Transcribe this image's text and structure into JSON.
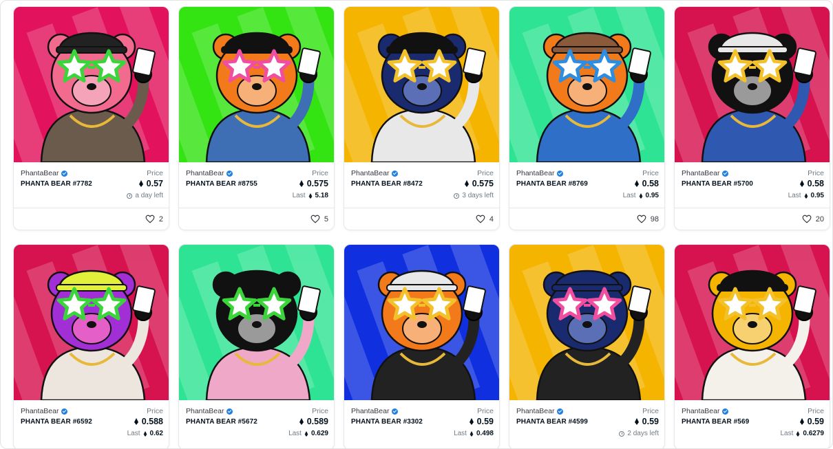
{
  "collection_name": "PhantaBear",
  "price_label": "Price",
  "last_label": "Last",
  "icons": {
    "verified": "verified-badge-icon",
    "currency": "eth-icon",
    "time": "clock-icon",
    "favorite": "heart-icon"
  },
  "colors": {
    "verified": "#2081e2",
    "muted": "#707a83",
    "text": "#04111d"
  },
  "items": [
    {
      "name": "PHANTA BEAR #7782",
      "price": "0.57",
      "sub_type": "time",
      "sub_text": "a day left",
      "likes": "2",
      "bg": "#e2135c",
      "fur": "#f26a8d",
      "face": "#f5a3b8",
      "star": "#3bd43b",
      "hat": "#222222",
      "jacket": "#6b5b4d"
    },
    {
      "name": "PHANTA BEAR #8755",
      "price": "0.575",
      "sub_type": "last",
      "sub_text": "5.18",
      "likes": "5",
      "bg": "#33e312",
      "fur": "#f27a1a",
      "face": "#f7b078",
      "star": "#f04fa0",
      "hat": "#111111",
      "jacket": "#3e6fb5"
    },
    {
      "name": "PHANTA BEAR #8472",
      "price": "0.575",
      "sub_type": "time",
      "sub_text": "3 days left",
      "likes": "4",
      "bg": "#f5b400",
      "fur": "#1a2a6e",
      "face": "#5a6fb5",
      "star": "#f3c12c",
      "hat": "#111111",
      "jacket": "#e8e8e8"
    },
    {
      "name": "PHANTA BEAR #8769",
      "price": "0.58",
      "sub_type": "last",
      "sub_text": "0.95",
      "likes": "98",
      "bg": "#2fe394",
      "fur": "#f27a1a",
      "face": "#f7b078",
      "star": "#2f8de0",
      "hat": "#8a5a3a",
      "jacket": "#2f6fc8"
    },
    {
      "name": "PHANTA BEAR #5700",
      "price": "0.58",
      "sub_type": "last",
      "sub_text": "0.95",
      "likes": "20",
      "bg": "#d6124f",
      "fur": "#111111",
      "face": "#9a9a9a",
      "star": "#f3c12c",
      "hat": "#e8e8e8",
      "jacket": "#2f58b0"
    },
    {
      "name": "PHANTA BEAR #6592",
      "price": "0.588",
      "sub_type": "last",
      "sub_text": "0.62",
      "likes": "",
      "bg": "#d6124f",
      "fur": "#a22fd6",
      "face": "#e45fc8",
      "star": "#3bd43b",
      "hat": "#e2f03a",
      "jacket": "#ece6df"
    },
    {
      "name": "PHANTA BEAR #5672",
      "price": "0.589",
      "sub_type": "last",
      "sub_text": "0.629",
      "likes": "",
      "bg": "#2fe394",
      "fur": "#111111",
      "face": "#9a9a9a",
      "star": "#3bd43b",
      "hat": "#111111",
      "jacket": "#f0a8c8"
    },
    {
      "name": "PHANTA BEAR #3302",
      "price": "0.59",
      "sub_type": "last",
      "sub_text": "0.498",
      "likes": "",
      "bg": "#1030e0",
      "fur": "#f27a1a",
      "face": "#f7b078",
      "star": "#f3c12c",
      "hat": "#e8e8e8",
      "jacket": "#222222"
    },
    {
      "name": "PHANTA BEAR #4599",
      "price": "0.59",
      "sub_type": "time",
      "sub_text": "2 days left",
      "likes": "",
      "bg": "#f5b400",
      "fur": "#1a2a6e",
      "face": "#5a6fb5",
      "star": "#f04fa0",
      "hat": "#1a2a6e",
      "jacket": "#222222"
    },
    {
      "name": "PHANTA BEAR #569",
      "price": "0.59",
      "sub_type": "last",
      "sub_text": "0.6279",
      "likes": "",
      "bg": "#d6124f",
      "fur": "#f5b400",
      "face": "#f7d070",
      "star": "#f3c12c",
      "hat": "#111111",
      "jacket": "#f4f0ea"
    }
  ]
}
